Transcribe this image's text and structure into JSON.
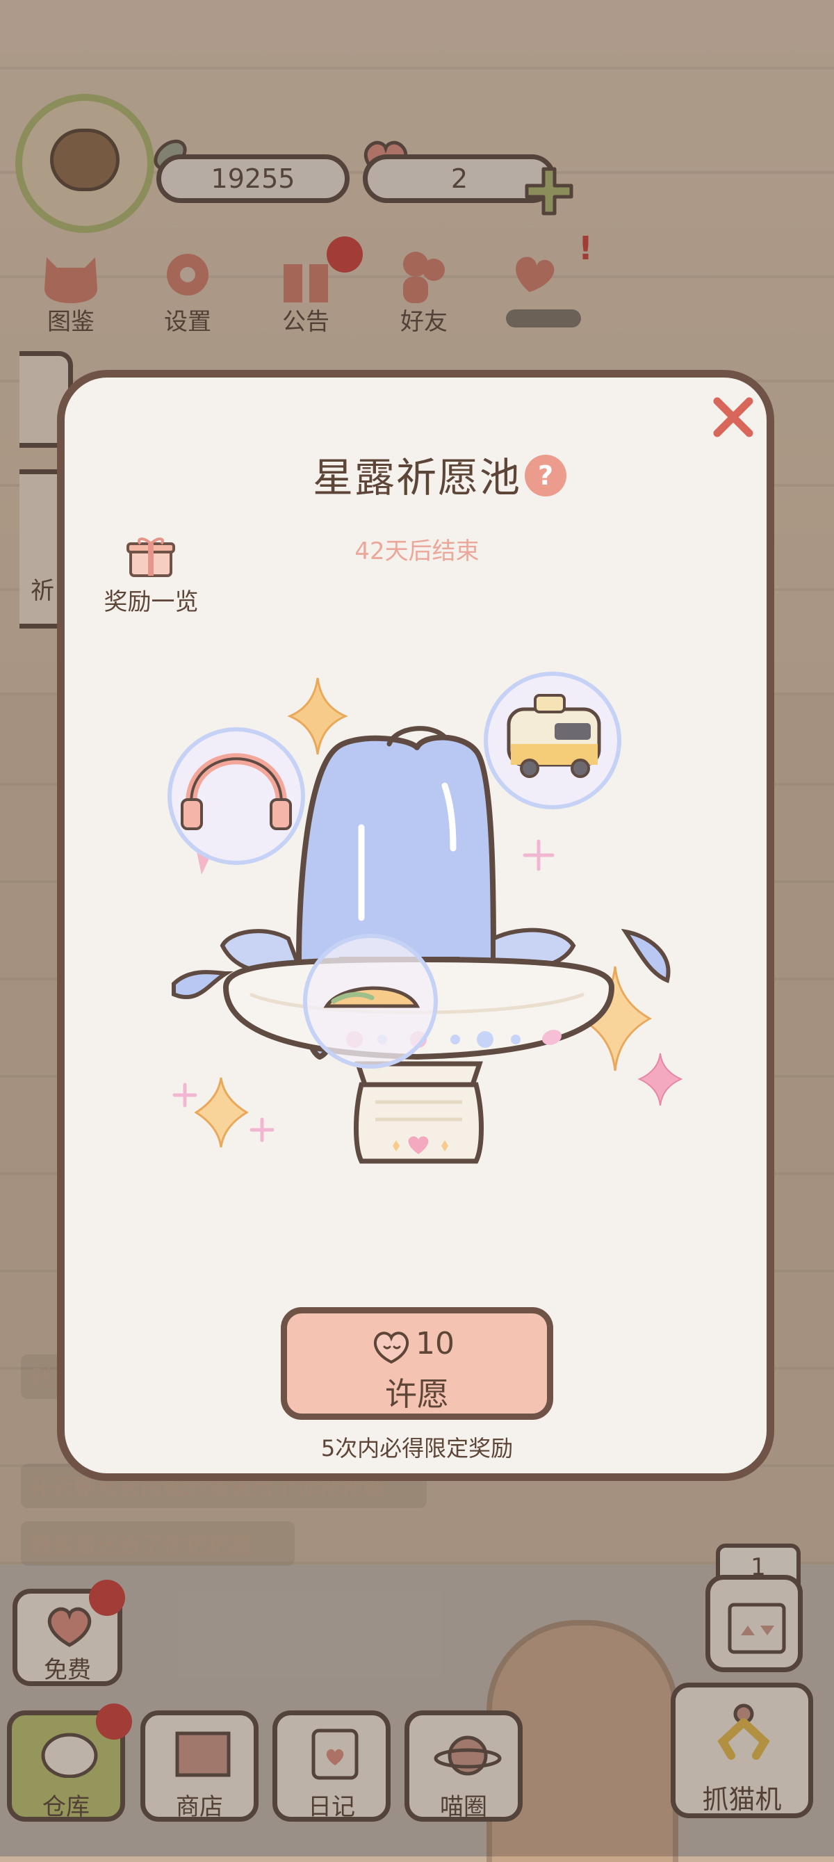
{
  "hud": {
    "fish_count": "19255",
    "heart_count": "2"
  },
  "top_nav": [
    {
      "label": "图鉴",
      "icon": "cat-head-icon"
    },
    {
      "label": "设置",
      "icon": "gear-icon"
    },
    {
      "label": "公告",
      "icon": "gift-icon"
    },
    {
      "label": "好友",
      "icon": "friends-icon"
    },
    {
      "label": "",
      "icon": "hearts-icon"
    }
  ],
  "left_tab_char": "祈",
  "chat": [
    "剁",
    "补药删我去囤糖的赠送给了你粑粑糖",
    "魏酱赠送给了你粑粑糖"
  ],
  "bottom_nav": {
    "free_label": "免费",
    "warehouse_label": "仓库",
    "shop_label": "商店",
    "diary_label": "日记",
    "circle_label": "喵圈",
    "claw_label": "抓猫机",
    "claw_count": "1"
  },
  "modal": {
    "title": "星露祈愿池",
    "countdown": "42天后结束",
    "reward_list_label": "奖励一览",
    "wish_cost": "10",
    "wish_label": "许愿",
    "guarantee_text": "5次内必得限定奖励",
    "reward_items": [
      "headphones",
      "camper-van",
      "fish-plate"
    ]
  },
  "colors": {
    "modal_border": "#6e5346",
    "modal_bg": "#f5f1ec",
    "wish_button": "#f4c3b2",
    "countdown_text": "#eba89a",
    "red_badge": "#c8403a",
    "accent_green": "#a9b06c"
  }
}
